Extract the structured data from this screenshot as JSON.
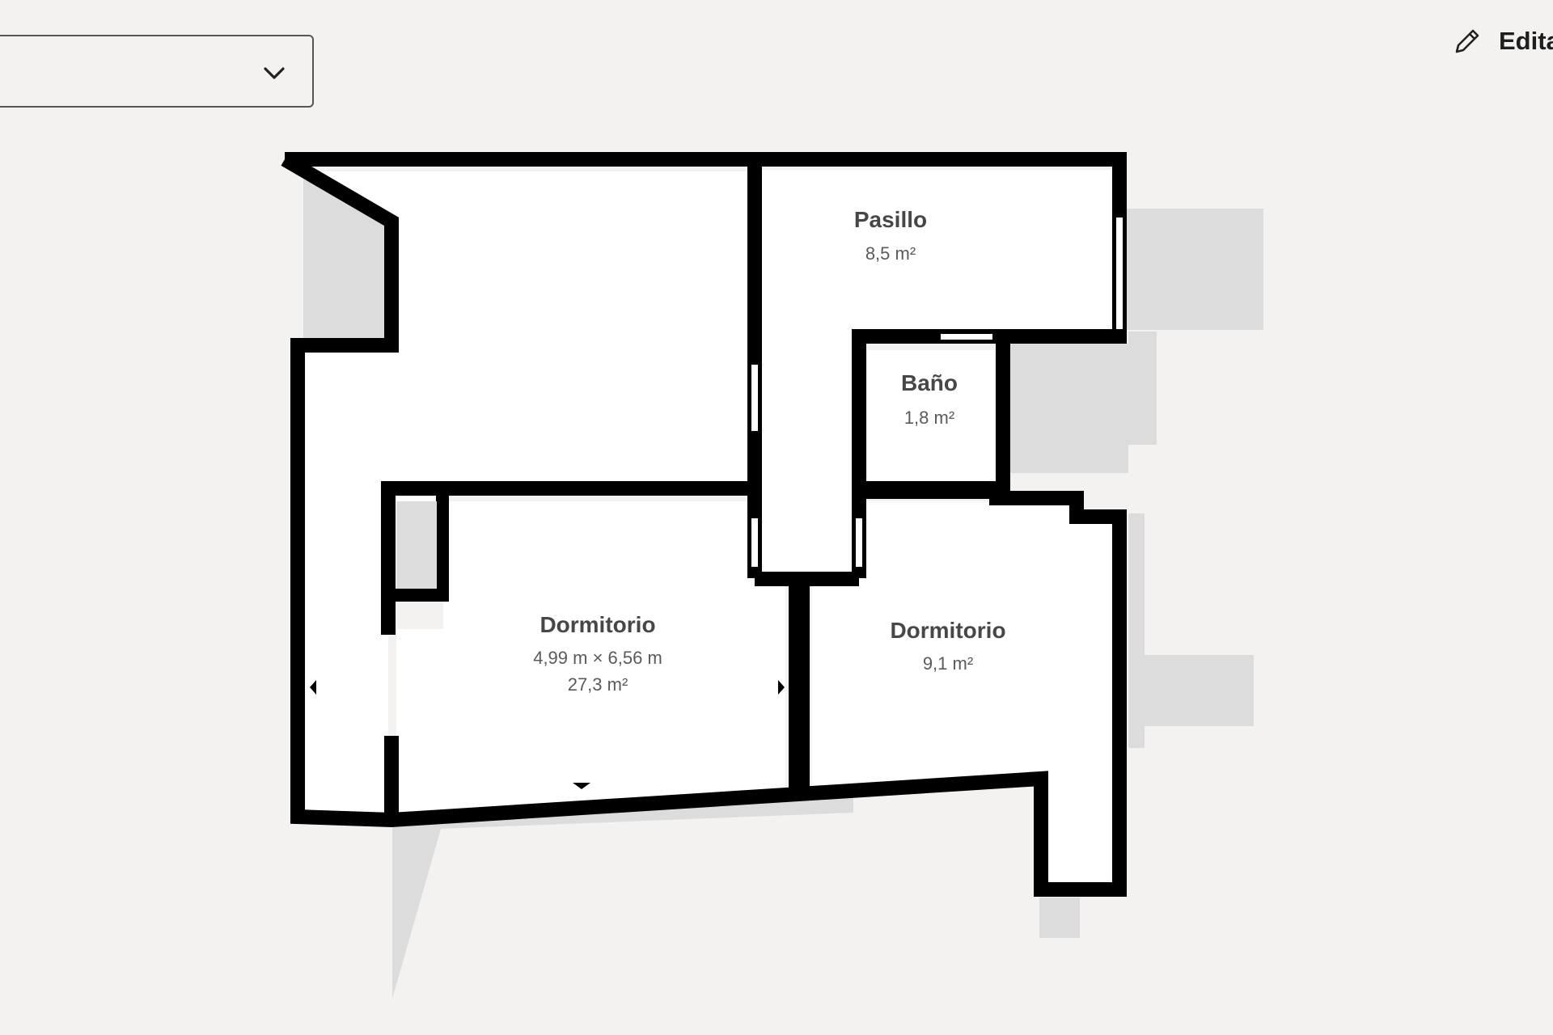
{
  "toolbar": {
    "floor_selector": {
      "selected_value": "",
      "icon": "chevron-down-icon"
    },
    "edit_button": {
      "label": "Editar",
      "icon": "pencil-icon"
    }
  },
  "floorplan": {
    "rooms": [
      {
        "id": "pasillo",
        "name": "Pasillo",
        "area": "8,5 m²"
      },
      {
        "id": "bano",
        "name": "Baño",
        "area": "1,8 m²"
      },
      {
        "id": "dormitorio-main",
        "name": "Dormitorio",
        "dimensions": "4,99 m × 6,56 m",
        "area": "27,3 m²"
      },
      {
        "id": "dormitorio-2",
        "name": "Dormitorio",
        "area": "9,1 m²"
      }
    ],
    "colors": {
      "background": "#f3f2f0",
      "wall": "#000000",
      "room_fill": "#ffffff",
      "shadow": "#dcdcdc",
      "label": "#474747"
    }
  }
}
